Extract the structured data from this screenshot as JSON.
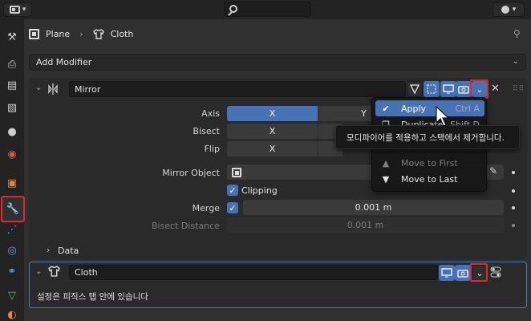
{
  "breadcrumb": {
    "object": "Plane",
    "modifier": "Cloth"
  },
  "add_modifier": {
    "label": "Add Modifier"
  },
  "mirror": {
    "name": "Mirror",
    "axis_label": "Axis",
    "bisect_label": "Bisect",
    "flip_label": "Flip",
    "axis_x": "X",
    "axis_y": "Y",
    "bisect_x": "X",
    "flip_x": "X",
    "mirror_object_label": "Mirror Object",
    "clipping_label": "Clipping",
    "merge_label": "Merge",
    "merge_value": "0.001 m",
    "bisect_distance_label": "Bisect Distance",
    "bisect_distance_value": "0.001 m",
    "data_label": "Data"
  },
  "dropdown_menu": {
    "items": [
      {
        "label": "Apply",
        "shortcut": "Ctrl A"
      },
      {
        "label": "Duplicate",
        "shortcut": "Shift D"
      },
      {
        "label": "Move to First"
      },
      {
        "label": "Move to Last"
      }
    ]
  },
  "tooltip": {
    "text": "모디파이어를 적용하고 스택에서 제거합니다."
  },
  "cloth": {
    "name": "Cloth",
    "note": "설정은 피직스 탭 안에 있습니다"
  },
  "colors": {
    "accent_blue": "#4772b3",
    "highlight_red": "#e0262f",
    "panel_bg": "#2a2a2a",
    "app_bg": "#303030"
  }
}
